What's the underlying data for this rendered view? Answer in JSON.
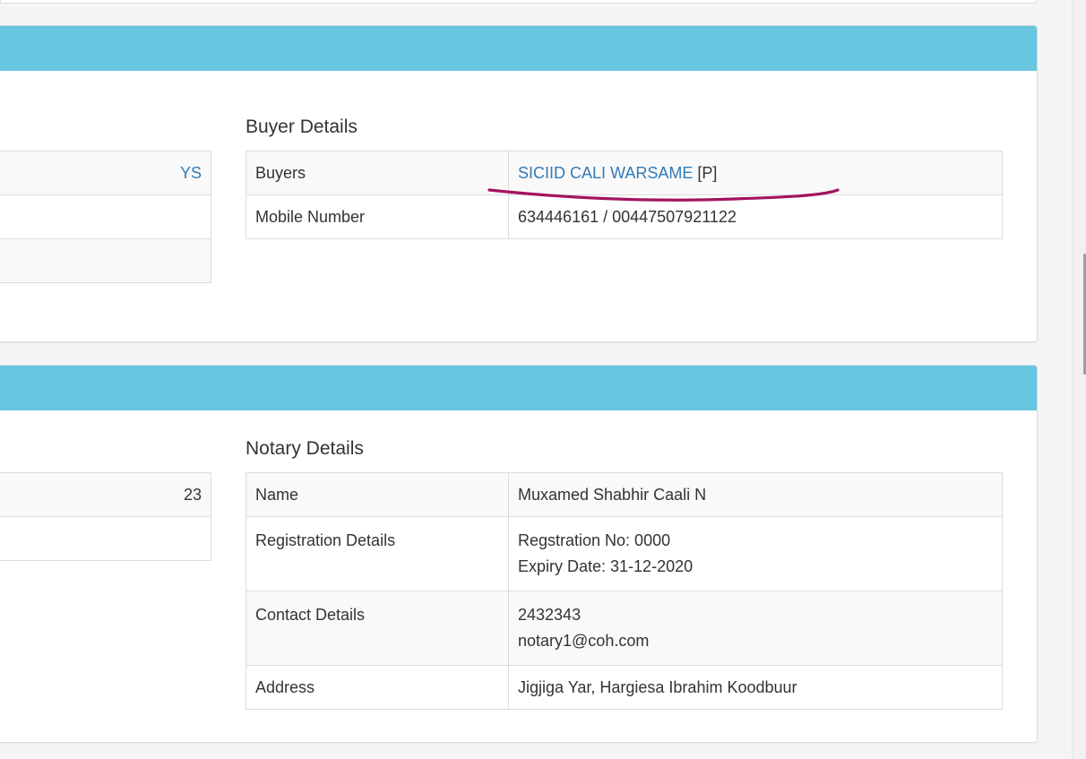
{
  "buyer_section": {
    "title": "Buyer Details",
    "left_stub_rows": [
      "YS",
      "",
      ""
    ],
    "rows": [
      {
        "label": "Buyers",
        "value_link": "SICIID CALI WARSAME",
        "value_suffix": " [P]"
      },
      {
        "label": "Mobile Number",
        "value": "634446161 / 00447507921122"
      }
    ]
  },
  "notary_section": {
    "title": "Notary Details",
    "left_stub_rows": [
      "23",
      ""
    ],
    "rows": [
      {
        "label": "Name",
        "line1": "Muxamed Shabhir Caali N",
        "line2": ""
      },
      {
        "label": "Registration Details",
        "line1": "Regstration No: 0000",
        "line2": "Expiry Date: 31-12-2020"
      },
      {
        "label": "Contact Details",
        "line1": "2432343",
        "line2": "notary1@coh.com"
      },
      {
        "label": "Address",
        "line1": "Jigjiga Yar, Hargiesa Ibrahim Koodbuur",
        "line2": ""
      }
    ]
  },
  "colors": {
    "panel_heading": "#67c5df",
    "link": "#337ab7",
    "annotation_stroke": "#a3145e"
  }
}
